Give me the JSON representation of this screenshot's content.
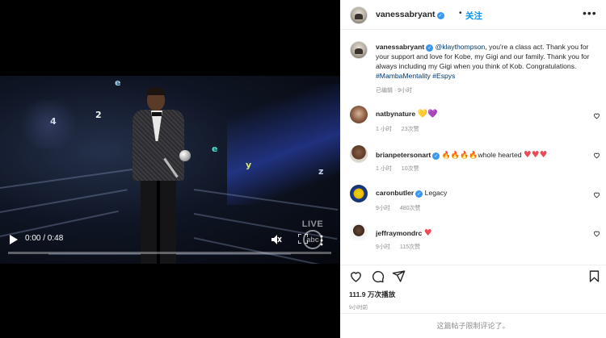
{
  "video": {
    "current_time": "0:00",
    "duration": "0:48",
    "time_label": "0:00 / 0:48",
    "progress": 0.0,
    "watermark_live": "LIVE",
    "watermark_network": "abc",
    "confetti": [
      {
        "ch": "e",
        "color": "#9fd4f0"
      },
      {
        "ch": "2",
        "color": "#f2f2f2"
      },
      {
        "ch": "4",
        "color": "#d0d8e8"
      },
      {
        "ch": "e",
        "color": "#4de0d0"
      },
      {
        "ch": "y",
        "color": "#d8e870"
      },
      {
        "ch": "z",
        "color": "#c8d0e8"
      }
    ],
    "icons": {
      "play": "play-icon",
      "mute": "speaker-muted-icon",
      "fullscreen": "fullscreen-icon",
      "more": "more-vertical-icon"
    }
  },
  "header": {
    "username": "vanessabryant",
    "verified": true,
    "dot": "•",
    "follow_label": "关注",
    "more_icon": "more-horizontal-icon"
  },
  "caption": {
    "username": "vanessabryant",
    "mention": "@klaythompson",
    "text": ", you're a class act. Thank you for your support and love for Kobe, my Gigi and our family. Thank you for always including my Gigi when you think of Kob. Congratulations.",
    "hashtag1": "#MambaMentality",
    "hashtag2": "#Espys",
    "edited": "已编辑",
    "time": "9小时"
  },
  "comments": [
    {
      "username": "natbynature",
      "verified": false,
      "text": "",
      "emojis": "💛💜",
      "time": "1 小时",
      "likes": "23次赞"
    },
    {
      "username": "brianpetersonart",
      "verified": true,
      "fires": "🔥🔥🔥🔥",
      "text": "whole hearted",
      "hearts": "♥♥♥",
      "time": "1 小时",
      "likes": "10次赞"
    },
    {
      "username": "caronbutler",
      "verified": true,
      "text": "Legacy",
      "time": "9小时",
      "likes": "480次赞"
    },
    {
      "username": "jeffraymondrc",
      "verified": false,
      "text": "",
      "hearts": "♥",
      "time": "9小时",
      "likes": "115次赞"
    }
  ],
  "actions": {
    "icons": [
      "heart-outline-icon",
      "comment-icon",
      "share-icon",
      "bookmark-icon"
    ]
  },
  "stats": {
    "views": "111.9 万次播放",
    "posted": "9小时前"
  },
  "footer": {
    "comments_limited": "这篇帖子限制评论了。"
  },
  "colors": {
    "link_blue": "#0095f6",
    "verified_blue": "#3897f0",
    "heart_red": "#ed4956",
    "muted_grey": "#8e8e8e"
  }
}
